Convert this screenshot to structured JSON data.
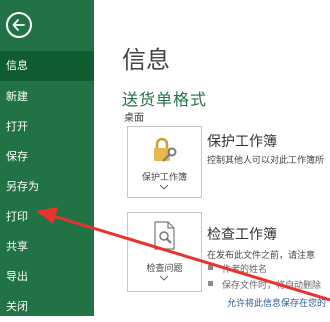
{
  "sidebar": {
    "items": [
      {
        "label": "信息",
        "active": true
      },
      {
        "label": "新建"
      },
      {
        "label": "打开"
      },
      {
        "label": "保存"
      },
      {
        "label": "另存为"
      },
      {
        "label": "打印"
      },
      {
        "label": "共享"
      },
      {
        "label": "导出"
      },
      {
        "label": "关闭"
      }
    ]
  },
  "main": {
    "title": "信息",
    "document_name": "送货单格式",
    "location": "桌面",
    "protect": {
      "button_label": "保护工作簿",
      "heading": "保护工作簿",
      "description": "控制其他人可以对此工作簿所"
    },
    "inspect": {
      "button_label": "检查问题",
      "heading": "检查工作簿",
      "description": "在发布此文件之前，请注意",
      "bullets": [
        "作者的姓名",
        "保存文件时，将自动删除"
      ],
      "link": "允许将此信息保存在您的"
    }
  },
  "colors": {
    "sidebar": "#217346",
    "sidebar_active": "#0e5c2f",
    "accent": "#217346",
    "annotation_arrow": "#e8322b"
  }
}
